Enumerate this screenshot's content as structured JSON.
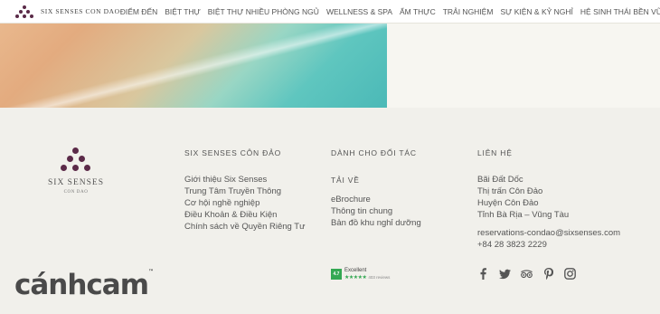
{
  "nav": {
    "brand": "SIX SENSES CON DAO",
    "items": [
      "ĐIỂM ĐẾN",
      "BIỆT THỰ",
      "BIỆT THỰ NHIỀU PHÒNG NGỦ",
      "WELLNESS & SPA",
      "ẨM THỰC",
      "TRẢI NGHIỆM",
      "SỰ KIỆN & KỶ NGHỈ",
      "HỆ SINH THÁI BỀN VỮNG"
    ]
  },
  "footer": {
    "logo": {
      "name": "SIX SENSES",
      "sub": "CON DAO"
    },
    "col1": {
      "heading": "SIX SENSES CÔN ĐẢO",
      "links": [
        "Giới thiệu Six Senses",
        "Trung Tâm Truyền Thông",
        "Cơ hội nghề nghiệp",
        "Điều Khoản & Điều Kiện",
        "Chính sách về Quyền Riêng Tư"
      ]
    },
    "col2": {
      "heading": "DÀNH CHO ĐỐI TÁC",
      "sub": "TẢI VỀ",
      "links": [
        "eBrochure",
        "Thông tin chung",
        "Bản đồ khu nghỉ dưỡng"
      ]
    },
    "col3": {
      "heading": "LIÊN HỆ",
      "address": [
        "Bãi Đất Dốc",
        "Thị trấn Côn Đảo",
        "Huyện Côn Đảo",
        "Tỉnh Bà Rịa – Vũng Tàu"
      ],
      "email": "reservations-condao@sixsenses.com",
      "phone": "+84  28 3823 2229"
    },
    "review": {
      "score": "4.7",
      "label": "Excellent",
      "stars": "★★★★★",
      "count": "403 reviews"
    },
    "social": [
      "facebook-icon",
      "twitter-icon",
      "tripadvisor-icon",
      "pinterest-icon",
      "instagram-icon"
    ]
  },
  "watermark": {
    "text": "cánhcam",
    "tm": "™"
  },
  "colors": {
    "brand_purple": "#5b2a48",
    "footer_bg": "#f1f0eb",
    "review_green": "#34a853"
  }
}
